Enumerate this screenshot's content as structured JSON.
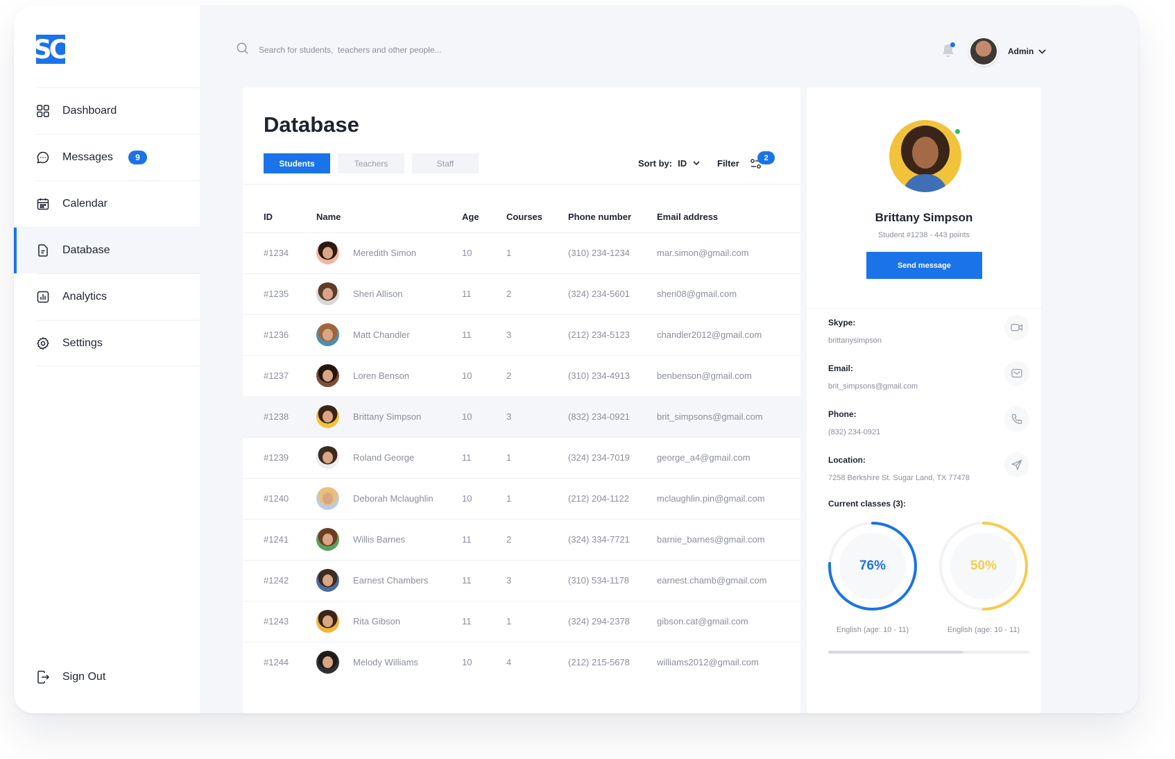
{
  "app": {
    "logo_text": "SC"
  },
  "sidebar": {
    "items": [
      {
        "label": "Dashboard",
        "icon": "grid-icon"
      },
      {
        "label": "Messages",
        "icon": "chat-icon",
        "badge": "9"
      },
      {
        "label": "Calendar",
        "icon": "calendar-icon"
      },
      {
        "label": "Database",
        "icon": "document-icon",
        "active": true
      },
      {
        "label": "Analytics",
        "icon": "bar-chart-icon"
      },
      {
        "label": "Settings",
        "icon": "gear-icon"
      }
    ],
    "signout": "Sign Out"
  },
  "header": {
    "search_placeholder": "Search for students,  teachers and other people...",
    "user": "Admin"
  },
  "main": {
    "title": "Database",
    "tabs": [
      "Students",
      "Teachers",
      "Staff"
    ],
    "active_tab": "Students",
    "sort_label": "Sort by:",
    "sort_value": "ID",
    "filter_label": "Filter",
    "filter_count": "2",
    "columns": [
      "ID",
      "Name",
      "Age",
      "Courses",
      "Phone number",
      "Email address"
    ],
    "rows": [
      {
        "id": "#1234",
        "name": "Meredith Simon",
        "age": "10",
        "courses": "1",
        "phone": "(310) 234-1234",
        "email": "mar.simon@gmail.com",
        "bg": "#f3b6a4",
        "hair": "#2b1a12"
      },
      {
        "id": "#1235",
        "name": "Sheri Allison",
        "age": "11",
        "courses": "2",
        "phone": "(324) 234-5601",
        "email": "sheri08@gmail.com",
        "bg": "#d8d8da",
        "hair": "#5a3d2b"
      },
      {
        "id": "#1236",
        "name": "Matt Chandler",
        "age": "11",
        "courses": "3",
        "phone": "(212) 234-5123",
        "email": "chandler2012@gmail.com",
        "bg": "#4b8fb0",
        "hair": "#a0653a"
      },
      {
        "id": "#1237",
        "name": "Loren Benson",
        "age": "10",
        "courses": "2",
        "phone": "(310) 234-4913",
        "email": "benbenson@gmail.com",
        "bg": "#7a4f3a",
        "hair": "#241510"
      },
      {
        "id": "#1238",
        "name": "Brittany Simpson",
        "age": "10",
        "courses": "3",
        "phone": "(832) 234-0921",
        "email": "brit_simpsons@gmail.com",
        "bg": "#f2c23b",
        "hair": "#3a2418",
        "selected": true
      },
      {
        "id": "#1239",
        "name": "Roland George",
        "age": "11",
        "courses": "1",
        "phone": "(324) 234-7019",
        "email": "george_a4@gmail.com",
        "bg": "#ececee",
        "hair": "#3b2a21"
      },
      {
        "id": "#1240",
        "name": "Deborah Mclaughlin",
        "age": "10",
        "courses": "1",
        "phone": "(212) 204-1122",
        "email": "mclaughlin.pin@gmail.com",
        "bg": "#b9cde3",
        "hair": "#e8c07a"
      },
      {
        "id": "#1241",
        "name": "Willis Barnes",
        "age": "11",
        "courses": "2",
        "phone": "(324) 334-7721",
        "email": "barnie_barnes@gmail.com",
        "bg": "#5aa15b",
        "hair": "#6b3f24"
      },
      {
        "id": "#1242",
        "name": "Earnest Chambers",
        "age": "11",
        "courses": "3",
        "phone": "(310) 534-1178",
        "email": "earnest.chamb@gmail.com",
        "bg": "#4a6c9a",
        "hair": "#3c2b20"
      },
      {
        "id": "#1243",
        "name": "Rita Gibson",
        "age": "11",
        "courses": "1",
        "phone": "(324) 294-2378",
        "email": "gibson.cat@gmail.com",
        "bg": "#f1b538",
        "hair": "#3a2418"
      },
      {
        "id": "#1244",
        "name": "Melody Williams",
        "age": "10",
        "courses": "4",
        "phone": "(212) 215-5678",
        "email": "williams2012@gmail.com",
        "bg": "#2f2f35",
        "hair": "#1e1b18"
      }
    ]
  },
  "profile": {
    "name": "Brittany Simpson",
    "subtitle": "Student #1238 - 443 points",
    "send_label": "Send message",
    "skype_label": "Skype:",
    "skype": "brittanysimpson",
    "email_label": "Email:",
    "email": "brit_simpsons@gmail.com",
    "phone_label": "Phone:",
    "phone": "(832) 234-0921",
    "location_label": "Location:",
    "location": "7258 Berkshire St. Sugar Land, TX 77478",
    "classes_title": "Current classes (3):",
    "classes": [
      {
        "percent_label": "76%",
        "progress": 0.76,
        "caption": "English (age: 10 - 11)",
        "color": "#1a73e8"
      },
      {
        "percent_label": "50%",
        "progress": 0.5,
        "caption": "English (age: 10 - 11)",
        "color": "#f8cb4a"
      }
    ]
  },
  "colors": {
    "accent": "#1a73e8",
    "online": "#27c24c",
    "yellow": "#f8cb4a"
  }
}
